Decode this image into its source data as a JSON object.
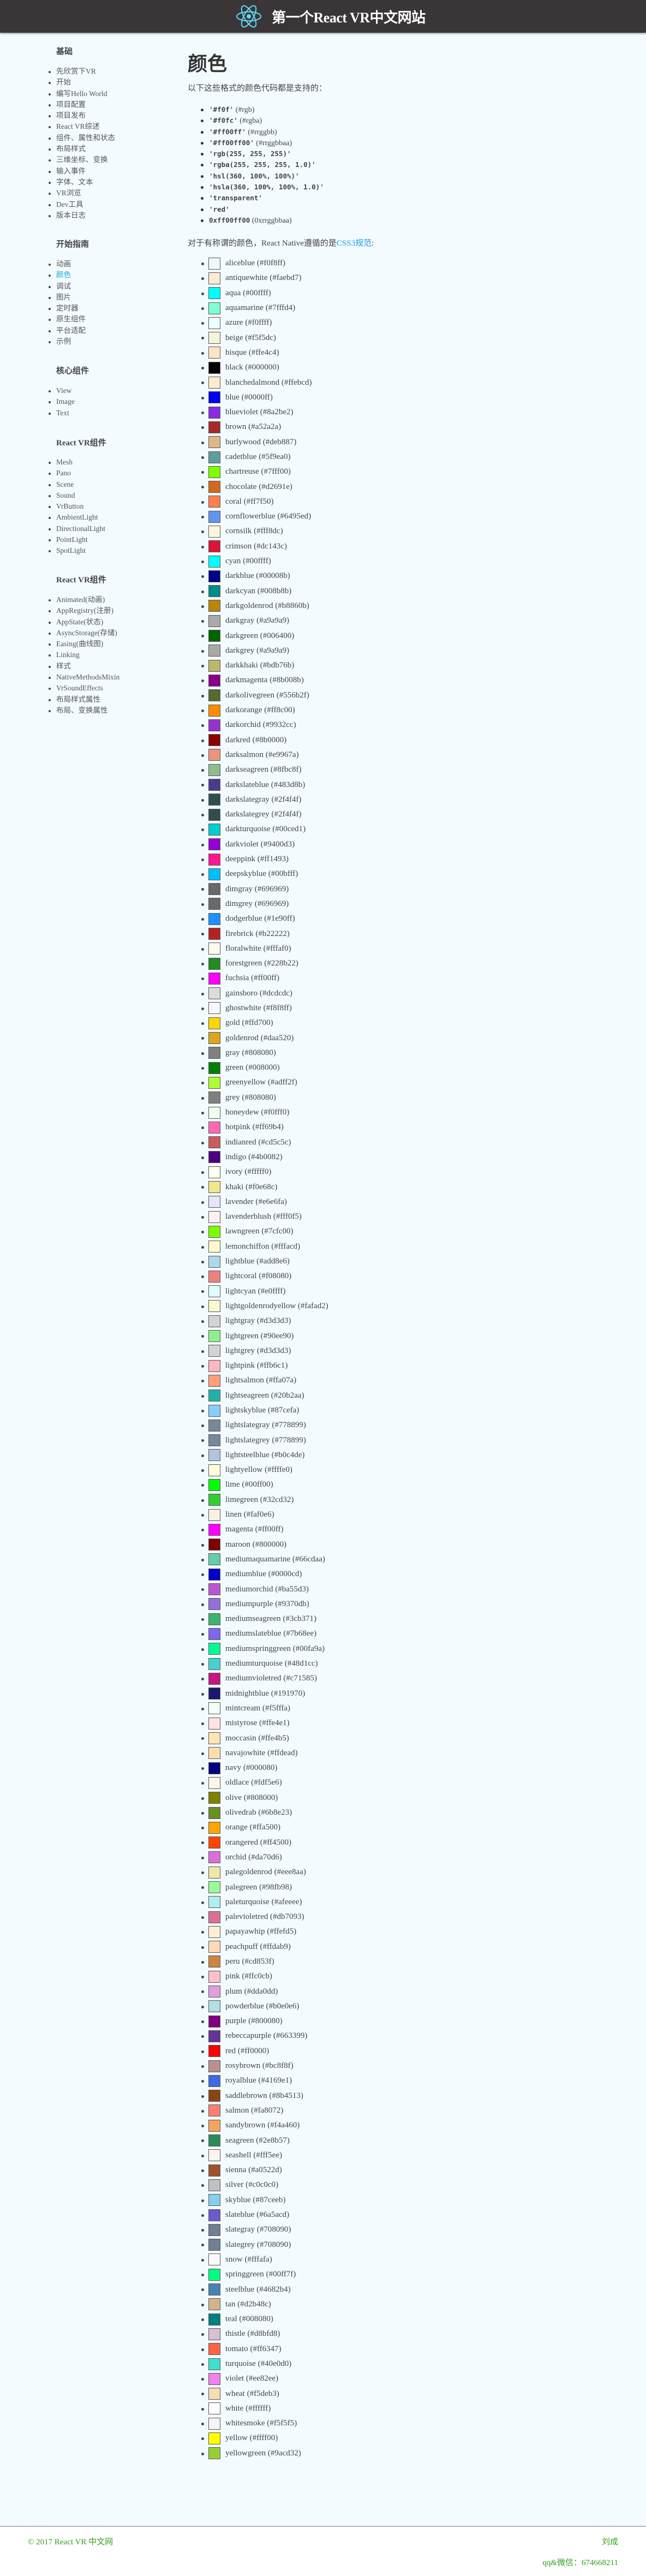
{
  "header": {
    "title": "第一个React VR中文网站",
    "logo_color": "#61dafb",
    "background": "#3a3637"
  },
  "sidebar": {
    "sections": [
      {
        "title": "基础",
        "items": [
          "先欣赏下VR",
          "开始",
          "编写Hello World",
          "项目配置",
          "项目发布",
          "React VR综述",
          "组件、属性和状态",
          "布局样式",
          "三维坐标、变换",
          "输入事件",
          "字体、文本",
          "VR浏览",
          "Dev工具",
          "版本日志"
        ]
      },
      {
        "title": "开始指南",
        "items": [
          "动画",
          "颜色",
          "调试",
          "图片",
          "定时器",
          "原生组件",
          "平台适配",
          "示例"
        ],
        "active": "颜色"
      },
      {
        "title": "核心组件",
        "items": [
          "View",
          "Image",
          "Text"
        ]
      },
      {
        "title": "React VR组件",
        "items": [
          "Mesh",
          "Pano",
          "Scene",
          "Sound",
          "VrButton",
          "AmbientLight",
          "DirectionalLight",
          "PointLight",
          "SpotLight"
        ]
      },
      {
        "title": "React VR组件",
        "items": [
          "Animated(动画)",
          "AppRegistry(注册)",
          "AppState(状态)",
          "AsyncStorage(存储)",
          "Easing(曲线图)",
          "Linking",
          "样式",
          "NativeMethodsMixin",
          "VrSoundEffects",
          "布局样式属性",
          "布局、变换属性"
        ]
      }
    ]
  },
  "main": {
    "title": "颜色",
    "intro": "以下这些格式的颜色代码都是支持的：",
    "formats": [
      {
        "code": "'#f0f'",
        "note": " (#rgb)"
      },
      {
        "code": "'#f0fc'",
        "note": " (#rgba)"
      },
      {
        "code": "'#ff00ff'",
        "note": " (#rrggbb)"
      },
      {
        "code": "'#ff00ff00'",
        "note": " (#rrggbbaa)"
      },
      {
        "code": "'rgb(255, 255, 255)'",
        "note": ""
      },
      {
        "code": "'rgba(255, 255, 255, 1.0)'",
        "note": ""
      },
      {
        "code": "'hsl(360, 100%, 100%)'",
        "note": ""
      },
      {
        "code": "'hsla(360, 100%, 100%, 1.0)'",
        "note": ""
      },
      {
        "code": "'transparent'",
        "note": ""
      },
      {
        "code": "'red'",
        "note": ""
      },
      {
        "code": "0xff00ff00",
        "note": " (0xrrggbbaa)"
      }
    ],
    "named_intro": "对于有称谓的颜色，React Native遵循的是",
    "named_link": "CSS3规范",
    "named_suffix": ":",
    "colors": [
      [
        "aliceblue",
        "#f0f8ff"
      ],
      [
        "antiquewhite",
        "#faebd7"
      ],
      [
        "aqua",
        "#00ffff"
      ],
      [
        "aquamarine",
        "#7fffd4"
      ],
      [
        "azure",
        "#f0ffff"
      ],
      [
        "beige",
        "#f5f5dc"
      ],
      [
        "bisque",
        "#ffe4c4"
      ],
      [
        "black",
        "#000000"
      ],
      [
        "blanchedalmond",
        "#ffebcd"
      ],
      [
        "blue",
        "#0000ff"
      ],
      [
        "blueviolet",
        "#8a2be2"
      ],
      [
        "brown",
        "#a52a2a"
      ],
      [
        "burlywood",
        "#deb887"
      ],
      [
        "cadetblue",
        "#5f9ea0"
      ],
      [
        "chartreuse",
        "#7fff00"
      ],
      [
        "chocolate",
        "#d2691e"
      ],
      [
        "coral",
        "#ff7f50"
      ],
      [
        "cornflowerblue",
        "#6495ed"
      ],
      [
        "cornsilk",
        "#fff8dc"
      ],
      [
        "crimson",
        "#dc143c"
      ],
      [
        "cyan",
        "#00ffff"
      ],
      [
        "darkblue",
        "#00008b"
      ],
      [
        "darkcyan",
        "#008b8b"
      ],
      [
        "darkgoldenrod",
        "#b8860b"
      ],
      [
        "darkgray",
        "#a9a9a9"
      ],
      [
        "darkgreen",
        "#006400"
      ],
      [
        "darkgrey",
        "#a9a9a9"
      ],
      [
        "darkkhaki",
        "#bdb76b"
      ],
      [
        "darkmagenta",
        "#8b008b"
      ],
      [
        "darkolivegreen",
        "#556b2f"
      ],
      [
        "darkorange",
        "#ff8c00"
      ],
      [
        "darkorchid",
        "#9932cc"
      ],
      [
        "darkred",
        "#8b0000"
      ],
      [
        "darksalmon",
        "#e9967a"
      ],
      [
        "darkseagreen",
        "#8fbc8f"
      ],
      [
        "darkslateblue",
        "#483d8b"
      ],
      [
        "darkslategray",
        "#2f4f4f"
      ],
      [
        "darkslategrey",
        "#2f4f4f"
      ],
      [
        "darkturquoise",
        "#00ced1"
      ],
      [
        "darkviolet",
        "#9400d3"
      ],
      [
        "deeppink",
        "#ff1493"
      ],
      [
        "deepskyblue",
        "#00bfff"
      ],
      [
        "dimgray",
        "#696969"
      ],
      [
        "dimgrey",
        "#696969"
      ],
      [
        "dodgerblue",
        "#1e90ff"
      ],
      [
        "firebrick",
        "#b22222"
      ],
      [
        "floralwhite",
        "#fffaf0"
      ],
      [
        "forestgreen",
        "#228b22"
      ],
      [
        "fuchsia",
        "#ff00ff"
      ],
      [
        "gainsboro",
        "#dcdcdc"
      ],
      [
        "ghostwhite",
        "#f8f8ff"
      ],
      [
        "gold",
        "#ffd700"
      ],
      [
        "goldenrod",
        "#daa520"
      ],
      [
        "gray",
        "#808080"
      ],
      [
        "green",
        "#008000"
      ],
      [
        "greenyellow",
        "#adff2f"
      ],
      [
        "grey",
        "#808080"
      ],
      [
        "honeydew",
        "#f0fff0"
      ],
      [
        "hotpink",
        "#ff69b4"
      ],
      [
        "indianred",
        "#cd5c5c"
      ],
      [
        "indigo",
        "#4b0082"
      ],
      [
        "ivory",
        "#fffff0"
      ],
      [
        "khaki",
        "#f0e68c"
      ],
      [
        "lavender",
        "#e6e6fa"
      ],
      [
        "lavenderblush",
        "#fff0f5"
      ],
      [
        "lawngreen",
        "#7cfc00"
      ],
      [
        "lemonchiffon",
        "#fffacd"
      ],
      [
        "lightblue",
        "#add8e6"
      ],
      [
        "lightcoral",
        "#f08080"
      ],
      [
        "lightcyan",
        "#e0ffff"
      ],
      [
        "lightgoldenrodyellow",
        "#fafad2"
      ],
      [
        "lightgray",
        "#d3d3d3"
      ],
      [
        "lightgreen",
        "#90ee90"
      ],
      [
        "lightgrey",
        "#d3d3d3"
      ],
      [
        "lightpink",
        "#ffb6c1"
      ],
      [
        "lightsalmon",
        "#ffa07a"
      ],
      [
        "lightseagreen",
        "#20b2aa"
      ],
      [
        "lightskyblue",
        "#87cefa"
      ],
      [
        "lightslategray",
        "#778899"
      ],
      [
        "lightslategrey",
        "#778899"
      ],
      [
        "lightsteelblue",
        "#b0c4de"
      ],
      [
        "lightyellow",
        "#ffffe0"
      ],
      [
        "lime",
        "#00ff00"
      ],
      [
        "limegreen",
        "#32cd32"
      ],
      [
        "linen",
        "#faf0e6"
      ],
      [
        "magenta",
        "#ff00ff"
      ],
      [
        "maroon",
        "#800000"
      ],
      [
        "mediumaquamarine",
        "#66cdaa"
      ],
      [
        "mediumblue",
        "#0000cd"
      ],
      [
        "mediumorchid",
        "#ba55d3"
      ],
      [
        "mediumpurple",
        "#9370db"
      ],
      [
        "mediumseagreen",
        "#3cb371"
      ],
      [
        "mediumslateblue",
        "#7b68ee"
      ],
      [
        "mediumspringgreen",
        "#00fa9a"
      ],
      [
        "mediumturquoise",
        "#48d1cc"
      ],
      [
        "mediumvioletred",
        "#c71585"
      ],
      [
        "midnightblue",
        "#191970"
      ],
      [
        "mintcream",
        "#f5fffa"
      ],
      [
        "mistyrose",
        "#ffe4e1"
      ],
      [
        "moccasin",
        "#ffe4b5"
      ],
      [
        "navajowhite",
        "#ffdead"
      ],
      [
        "navy",
        "#000080"
      ],
      [
        "oldlace",
        "#fdf5e6"
      ],
      [
        "olive",
        "#808000"
      ],
      [
        "olivedrab",
        "#6b8e23"
      ],
      [
        "orange",
        "#ffa500"
      ],
      [
        "orangered",
        "#ff4500"
      ],
      [
        "orchid",
        "#da70d6"
      ],
      [
        "palegoldenrod",
        "#eee8aa"
      ],
      [
        "palegreen",
        "#98fb98"
      ],
      [
        "paleturquoise",
        "#afeeee"
      ],
      [
        "palevioletred",
        "#db7093"
      ],
      [
        "papayawhip",
        "#ffefd5"
      ],
      [
        "peachpuff",
        "#ffdab9"
      ],
      [
        "peru",
        "#cd853f"
      ],
      [
        "pink",
        "#ffc0cb"
      ],
      [
        "plum",
        "#dda0dd"
      ],
      [
        "powderblue",
        "#b0e0e6"
      ],
      [
        "purple",
        "#800080"
      ],
      [
        "rebeccapurple",
        "#663399"
      ],
      [
        "red",
        "#ff0000"
      ],
      [
        "rosybrown",
        "#bc8f8f"
      ],
      [
        "royalblue",
        "#4169e1"
      ],
      [
        "saddlebrown",
        "#8b4513"
      ],
      [
        "salmon",
        "#fa8072"
      ],
      [
        "sandybrown",
        "#f4a460"
      ],
      [
        "seagreen",
        "#2e8b57"
      ],
      [
        "seashell",
        "#fff5ee"
      ],
      [
        "sienna",
        "#a0522d"
      ],
      [
        "silver",
        "#c0c0c0"
      ],
      [
        "skyblue",
        "#87ceeb"
      ],
      [
        "slateblue",
        "#6a5acd"
      ],
      [
        "slategray",
        "#708090"
      ],
      [
        "slategrey",
        "#708090"
      ],
      [
        "snow",
        "#fffafa"
      ],
      [
        "springgreen",
        "#00ff7f"
      ],
      [
        "steelblue",
        "#4682b4"
      ],
      [
        "tan",
        "#d2b48c"
      ],
      [
        "teal",
        "#008080"
      ],
      [
        "thistle",
        "#d8bfd8"
      ],
      [
        "tomato",
        "#ff6347"
      ],
      [
        "turquoise",
        "#40e0d0"
      ],
      [
        "violet",
        "#ee82ee"
      ],
      [
        "wheat",
        "#f5deb3"
      ],
      [
        "white",
        "#ffffff"
      ],
      [
        "whitesmoke",
        "#f5f5f5"
      ],
      [
        "yellow",
        "#ffff00"
      ],
      [
        "yellowgreen",
        "#9acd32"
      ]
    ]
  },
  "footer": {
    "copyright": "© 2017 React VR 中文网",
    "author": "刘成",
    "contact": "qq&微信：674668211",
    "text_color": "#33a11c"
  }
}
